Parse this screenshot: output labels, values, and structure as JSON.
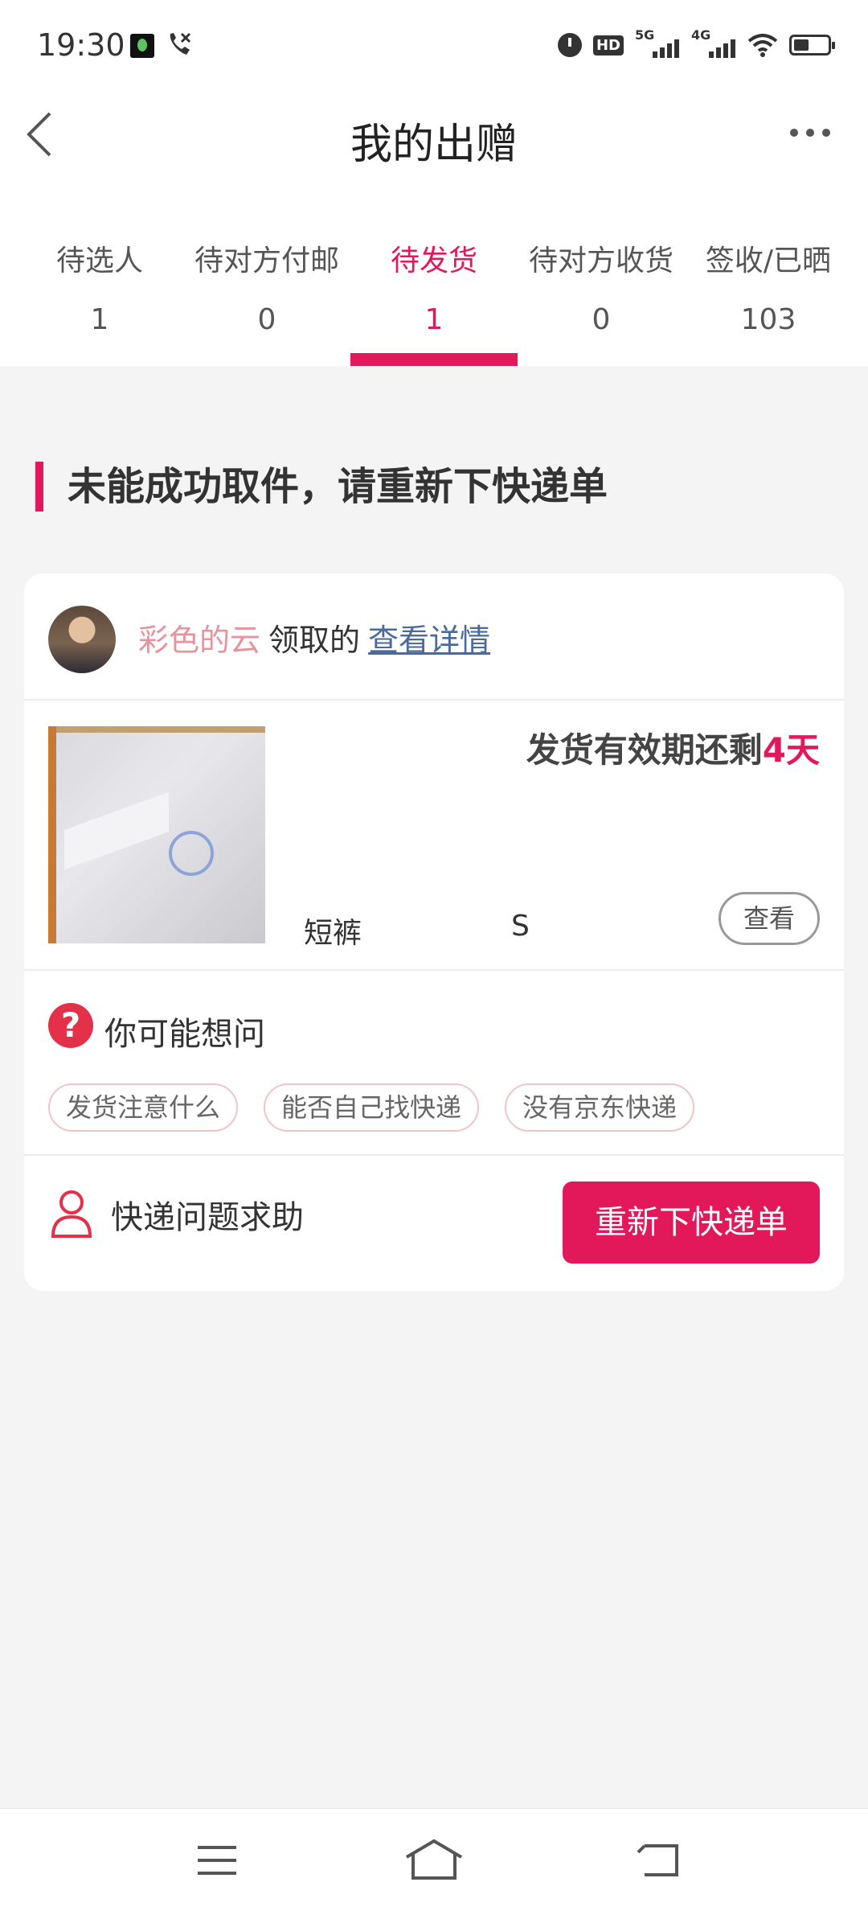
{
  "status_bar": {
    "time": "19:30",
    "hd_label": "HD",
    "net1": "5G",
    "net2": "4G",
    "icons": [
      "app-icon",
      "missed-call-icon",
      "alarm-icon",
      "hd-icon",
      "5g-signal-icon",
      "4g-signal-icon",
      "wifi-icon",
      "battery-icon"
    ]
  },
  "header": {
    "title": "我的出赠",
    "back_icon": "back-arrow-icon",
    "more_icon": "more-icon"
  },
  "tabs": [
    {
      "label": "待选人",
      "count": "1"
    },
    {
      "label": "待对方付邮",
      "count": "0"
    },
    {
      "label": "待发货",
      "count": "1",
      "active": true
    },
    {
      "label": "待对方收货",
      "count": "0"
    },
    {
      "label": "签收/已晒",
      "count": "103"
    }
  ],
  "section": {
    "heading": "未能成功取件，请重新下快递单"
  },
  "card": {
    "recipient": {
      "name": "彩色的云",
      "suffix": "领取的",
      "link": "查看详情"
    },
    "item": {
      "deadline_prefix": "发货有效期还剩",
      "deadline_days": "4天",
      "name": "短裤",
      "size": "S",
      "view_label": "查看"
    },
    "faq": {
      "title": "你可能想问",
      "icon": "question-icon",
      "chips": [
        "发货注意什么",
        "能否自己找快递",
        "没有京东快递"
      ]
    },
    "help": {
      "label": "快递问题求助",
      "icon": "person-icon",
      "button": "重新下快递单"
    }
  },
  "nav_bar": {
    "icons": [
      "menu-icon",
      "home-icon",
      "back-icon"
    ]
  },
  "colors": {
    "accent": "#e2185a",
    "recipient_name": "#e7929c",
    "link": "#4a6a9e",
    "background": "#f4f4f4"
  }
}
